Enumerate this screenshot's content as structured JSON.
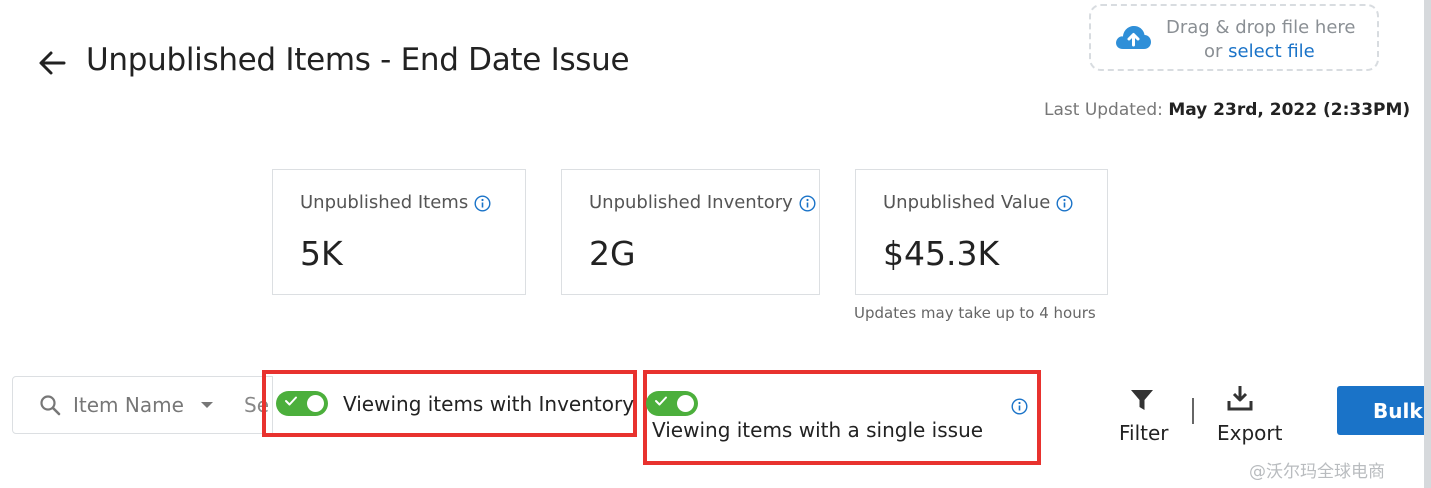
{
  "header": {
    "title": "Unpublished Items - End Date Issue",
    "back_icon": "arrow-left-icon"
  },
  "upload": {
    "icon": "cloud-upload-icon",
    "line1": "Drag & drop file here",
    "line2_prefix": "or ",
    "line2_link": "select file"
  },
  "last_updated": {
    "label": "Last Updated:",
    "value": "May 23rd, 2022 (2:33PM)"
  },
  "stats": [
    {
      "label": "Unpublished Items",
      "value": "5K"
    },
    {
      "label": "Unpublished Inventory",
      "value": "2G"
    },
    {
      "label": "Unpublished Value",
      "value": "$45.3K"
    }
  ],
  "stats_note": "Updates may take up to 4 hours",
  "toolbar": {
    "search_field_label": "Item Name",
    "search_input_partial": "Se",
    "toggle_inventory_label": "Viewing items with Inventory",
    "toggle_inventory_on": true,
    "toggle_single_issue_label": "Viewing items with a single issue",
    "toggle_single_issue_on": true,
    "filter_label": "Filter",
    "export_label": "Export",
    "bulk_label": "Bulk A"
  },
  "colors": {
    "accent": "#1a73c8",
    "toggle_on": "#4caf3c",
    "highlight": "#e8322e"
  },
  "watermark": "@沃尔玛全球电商"
}
